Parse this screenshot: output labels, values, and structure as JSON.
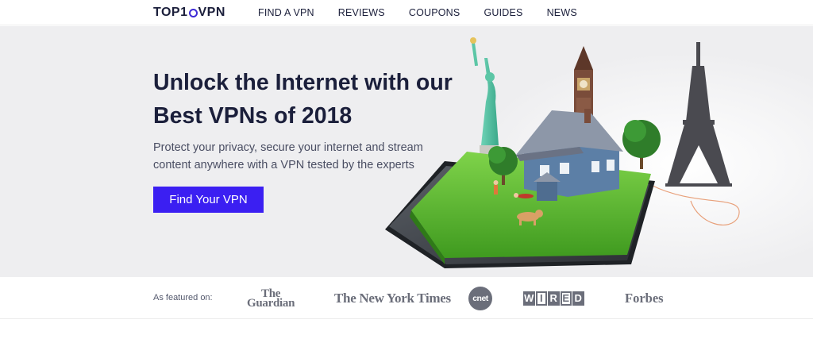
{
  "nav": {
    "logo_prefix": "TOP1",
    "logo_suffix": "VPN",
    "links": [
      "FIND A VPN",
      "REVIEWS",
      "COUPONS",
      "GUIDES",
      "NEWS"
    ]
  },
  "hero": {
    "headline": "Unlock the Internet with our Best VPNs of 2018",
    "subtitle": "Protect your privacy, secure your internet and stream content anywhere with a VPN tested by the experts",
    "cta_label": "Find Your VPN",
    "colors": {
      "cta": "#3b1ff2",
      "background": "#eeeef0",
      "headline": "#1b1f3b"
    }
  },
  "featured": {
    "label": "As featured on:",
    "guardian_top": "The",
    "guardian_bottom": "Guardian",
    "nyt": "The New York Times",
    "cnet": "cnet",
    "wired_letters": [
      "W",
      "I",
      "R",
      "E",
      "D"
    ],
    "forbes": "Forbes"
  }
}
